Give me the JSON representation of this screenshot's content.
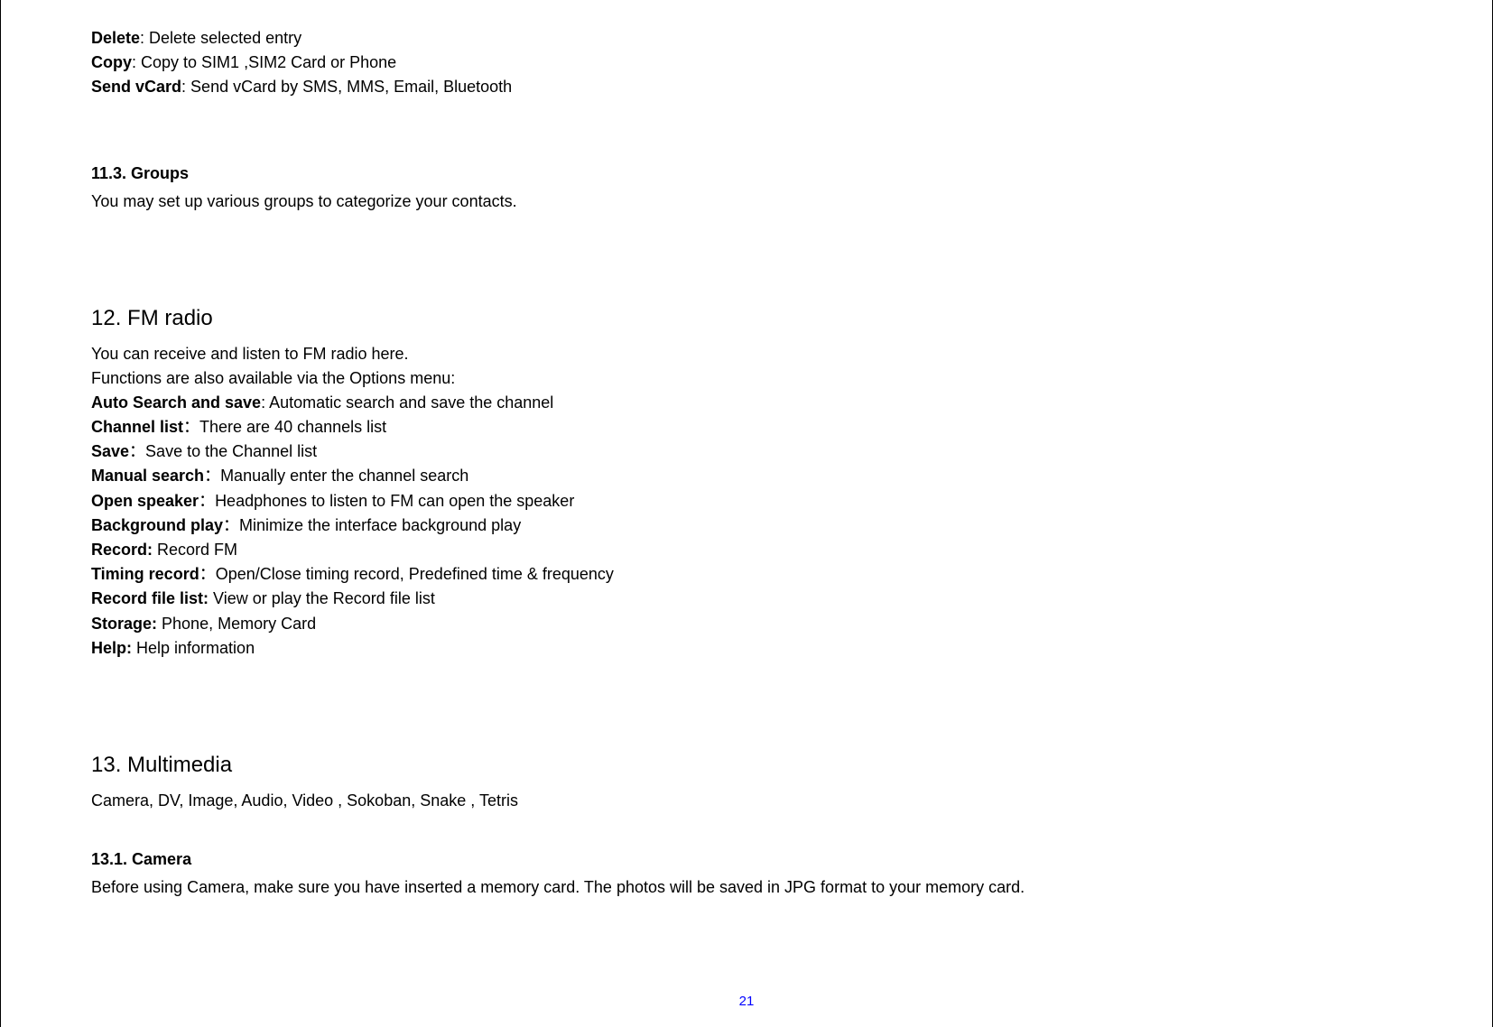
{
  "definitions_top": [
    {
      "term": "Delete",
      "sep": ": ",
      "desc": "Delete selected entry"
    },
    {
      "term": "Copy",
      "sep": ": ",
      "desc": "Copy to SIM1 ,SIM2 Card or Phone"
    },
    {
      "term": "Send vCard",
      "sep": ": ",
      "desc": "Send vCard by SMS, MMS, Email, Bluetooth"
    }
  ],
  "section_11_3": {
    "heading": "11.3.   Groups",
    "body": "You may set up various groups to categorize your contacts."
  },
  "section_12": {
    "heading": "12. FM  radio",
    "intro1": "You can receive and listen to FM radio here.",
    "intro2": "Functions are also available via the Options menu:",
    "definitions": [
      {
        "term": "Auto Search and save",
        "sep": ": ",
        "desc": "Automatic search and save the channel"
      },
      {
        "term": "Channel list",
        "sep": "：",
        "desc": "There are 40 channels list"
      },
      {
        "term": "Save",
        "sep": "：",
        "desc": "Save to the Channel list"
      },
      {
        "term": "Manual search",
        "sep": "：",
        "desc": "Manually enter the channel search"
      },
      {
        "term": "Open speaker",
        "sep": "：",
        "desc": "Headphones to listen to FM can open the speaker"
      },
      {
        "term": "Background play",
        "sep": "：",
        "desc": "Minimize the interface background play"
      },
      {
        "term": "Record:",
        "sep": " ",
        "desc": "Record FM"
      },
      {
        "term": "Timing record",
        "sep": "：",
        "desc": "Open/Close timing record, Predefined time & frequency"
      },
      {
        "term": "Record file list:",
        "sep": " ",
        "desc": "View or play the Record file list"
      },
      {
        "term": "Storage:",
        "sep": " ",
        "desc": "Phone, Memory Card"
      },
      {
        "term": "Help:",
        "sep": " ",
        "desc": "Help information"
      }
    ]
  },
  "section_13": {
    "heading": "13. Multimedia",
    "body": "Camera, DV, Image, Audio, Video , Sokoban, Snake , Tetris"
  },
  "section_13_1": {
    "heading": "13.1.   Camera",
    "body": "Before using Camera, make sure you have inserted a memory card. The photos will be saved in JPG format to your memory card."
  },
  "page_number": "21"
}
